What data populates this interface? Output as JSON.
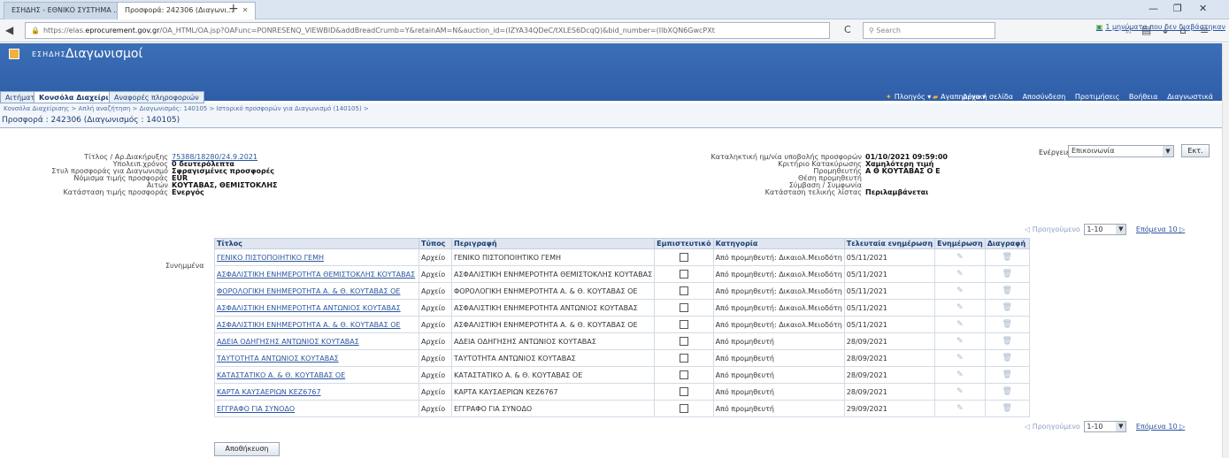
{
  "browser": {
    "tabs": [
      {
        "label": "ΕΣΗΔΗΣ - ΕΘΝΙΚΟ ΣΥΣΤΗΜΑ ..."
      },
      {
        "label": "Προσφορά: 242306 (Διαγωνι..."
      }
    ],
    "url_prefix": "https://elas.",
    "url_domain": "eprocurement.gov.gr",
    "url_rest": "/OA_HTML/OA.jsp?OAFunc=PONRESENQ_VIEWBID&addBreadCrumb=Y&retainAM=N&auction_id=(IZYA34QDeC/tXLES6DcqQ)&bid_number=(IlbXQN6GwcPXt",
    "search_placeholder": "Search"
  },
  "app": {
    "brand": "ΕΣΗΔΗΣ",
    "title": "Διαγωνισμοί",
    "menus": {
      "navigator": "Πλοηγός",
      "favorites": "Αγαπημένα"
    },
    "links": [
      "Αρχική σελίδα",
      "Αποσύνδεση",
      "Προτιμήσεις",
      "Βοήθεια",
      "Διαγνωστικά"
    ],
    "tabs": [
      "Αιτήματα",
      "Κονσόλα Διαχείρισης",
      "Αναφορές πληροφοριών"
    ]
  },
  "breadcrumb": "Κονσόλα Διαχείρισης >  Απλή αναζήτηση >  Διαγωνισμός: 140105 >  Ιστορικό προσφορών για Διαγωνισμό (140105) >",
  "page_title": "Προσφορά : 242306 (Διαγωνισμός : 140105)",
  "notice": "1 μηνύματα που δεν διαβάστηκαν",
  "actions": {
    "label": "Ενέργειες",
    "selected": "Επικοινωνία",
    "go": "Εκτ."
  },
  "details_left": [
    {
      "label": "Τίτλος / Αρ.Διακήρυξης",
      "value": "75388/18280/24.9.2021",
      "link": true
    },
    {
      "label": "Υπολειπ.χρόνος",
      "value": "0 δευτερόλεπτα",
      "link": false
    },
    {
      "label": "Στυλ προσφοράς για Διαγωνισμό",
      "value": "Σφραγισμένες προσφορές",
      "link": false
    },
    {
      "label": "Νόμισμα τιμής προσφοράς",
      "value": "EUR",
      "link": false
    },
    {
      "label": "Αιτών",
      "value": "ΚΟΥΤΑΒΑΣ, ΘΕΜΙΣΤΟΚΛΗΣ",
      "link": false
    },
    {
      "label": "Κατάσταση τιμής προσφοράς",
      "value": "Ενεργός",
      "link": false
    }
  ],
  "details_right": [
    {
      "label": "Καταληκτική ημ/νία υποβολής προσφορών",
      "value": "01/10/2021 09:59:00"
    },
    {
      "label": "Κριτήριο Κατακύρωσης",
      "value": "Χαμηλότερη τιμή"
    },
    {
      "label": "Προμηθευτής",
      "value": "Α Θ ΚΟΥΤΑΒΑΣ Ο Ε"
    },
    {
      "label": "Θέση προμηθευτή",
      "value": ""
    },
    {
      "label": "Σύμβαση / Συμφωνία",
      "value": ""
    },
    {
      "label": "Κατάσταση τελικής λίστας",
      "value": "Περιλαμβάνεται"
    }
  ],
  "attachments": {
    "label": "Συνημμένα",
    "pager": {
      "prev": "Προηγούμενο",
      "range": "1-10",
      "next": "Επόμενα 10"
    },
    "columns": [
      "Τίτλος",
      "Τύπος",
      "Περιγραφή",
      "Εμπιστευτικό",
      "Κατηγορία",
      "Τελευταία ενημέρωση",
      "Ενημέρωση",
      "Διαγραφή"
    ],
    "rows": [
      {
        "title": "ΓΕΝΙΚΟ ΠΙΣΤΟΠΟΙΗΤΙΚΟ ΓΕΜΗ",
        "type": "Αρχείο",
        "description": "ΓΕΝΙΚΟ ΠΙΣΤΟΠΟΙΗΤΙΚΟ ΓΕΜΗ",
        "category": "Από προμηθευτή: Δικαιολ.Μειοδότη",
        "updated": "05/11/2021"
      },
      {
        "title": "ΑΣΦΑΛΙΣΤΙΚΗ ΕΝΗΜΕΡΟΤΗΤΑ ΘΕΜΙΣΤΟΚΛΗΣ ΚΟΥΤΑΒΑΣ",
        "type": "Αρχείο",
        "description": "ΑΣΦΑΛΙΣΤΙΚΗ ΕΝΗΜΕΡΟΤΗΤΑ ΘΕΜΙΣΤΟΚΛΗΣ ΚΟΥΤΑΒΑΣ",
        "category": "Από προμηθευτή: Δικαιολ.Μειοδότη",
        "updated": "05/11/2021"
      },
      {
        "title": "ΦΟΡΟΛΟΓΙΚΗ ΕΝΗΜΕΡΟΤΗΤΑ Α. & Θ. ΚΟΥΤΑΒΑΣ ΟΕ",
        "type": "Αρχείο",
        "description": "ΦΟΡΟΛΟΓΙΚΗ ΕΝΗΜΕΡΟΤΗΤΑ Α. & Θ. ΚΟΥΤΑΒΑΣ ΟΕ",
        "category": "Από προμηθευτή: Δικαιολ.Μειοδότη",
        "updated": "05/11/2021"
      },
      {
        "title": "ΑΣΦΑΛΙΣΤΙΚΗ ΕΝΗΜΕΡΟΤΗΤΑ ΑΝΤΩΝΙΟΣ ΚΟΥΤΑΒΑΣ",
        "type": "Αρχείο",
        "description": "ΑΣΦΑΛΙΣΤΙΚΗ ΕΝΗΜΕΡΟΤΗΤΑ ΑΝΤΩΝΙΟΣ ΚΟΥΤΑΒΑΣ",
        "category": "Από προμηθευτή: Δικαιολ.Μειοδότη",
        "updated": "05/11/2021"
      },
      {
        "title": "ΑΣΦΑΛΙΣΤΙΚΗ ΕΝΗΜΕΡΟΤΗΤΑ Α. & Θ. ΚΟΥΤΑΒΑΣ ΟΕ",
        "type": "Αρχείο",
        "description": "ΑΣΦΑΛΙΣΤΙΚΗ ΕΝΗΜΕΡΟΤΗΤΑ Α. & Θ. ΚΟΥΤΑΒΑΣ ΟΕ",
        "category": "Από προμηθευτή: Δικαιολ.Μειοδότη",
        "updated": "05/11/2021"
      },
      {
        "title": "ΑΔΕΙΑ ΟΔΗΓΗΣΗΣ ΑΝΤΩΝΙΟΣ ΚΟΥΤΑΒΑΣ",
        "type": "Αρχείο",
        "description": "ΑΔΕΙΑ ΟΔΗΓΗΣΗΣ ΑΝΤΩΝΙΟΣ ΚΟΥΤΑΒΑΣ",
        "category": "Από προμηθευτή",
        "updated": "28/09/2021"
      },
      {
        "title": "ΤΑΥΤΟΤΗΤΑ ΑΝΤΩΝΙΟΣ ΚΟΥΤΑΒΑΣ",
        "type": "Αρχείο",
        "description": "ΤΑΥΤΟΤΗΤΑ ΑΝΤΩΝΙΟΣ ΚΟΥΤΑΒΑΣ",
        "category": "Από προμηθευτή",
        "updated": "28/09/2021"
      },
      {
        "title": "ΚΑΤΑΣΤΑΤΙΚΟ Α. & Θ. ΚΟΥΤΑΒΑΣ ΟΕ",
        "type": "Αρχείο",
        "description": "ΚΑΤΑΣΤΑΤΙΚΟ Α. & Θ. ΚΟΥΤΑΒΑΣ ΟΕ",
        "category": "Από προμηθευτή",
        "updated": "28/09/2021"
      },
      {
        "title": "ΚΑΡΤΑ ΚΑΥΣΑΕΡΙΩΝ ΚΕΖ6767",
        "type": "Αρχείο",
        "description": "ΚΑΡΤΑ ΚΑΥΣΑΕΡΙΩΝ ΚΕΖ6767",
        "category": "Από προμηθευτή",
        "updated": "28/09/2021"
      },
      {
        "title": "ΕΓΓΡΑΦΟ ΓΙΑ ΣΥΝΟΔΟ",
        "type": "Αρχείο",
        "description": "ΕΓΓΡΑΦΟ ΓΙΑ ΣΥΝΟΔΟ",
        "category": "Από προμηθευτή",
        "updated": "29/09/2021"
      }
    ]
  },
  "save_button": "Αποθήκευση",
  "colors": {
    "header": "#2e5ea8",
    "link": "#2a56a0",
    "accent": "#f4b03a"
  }
}
